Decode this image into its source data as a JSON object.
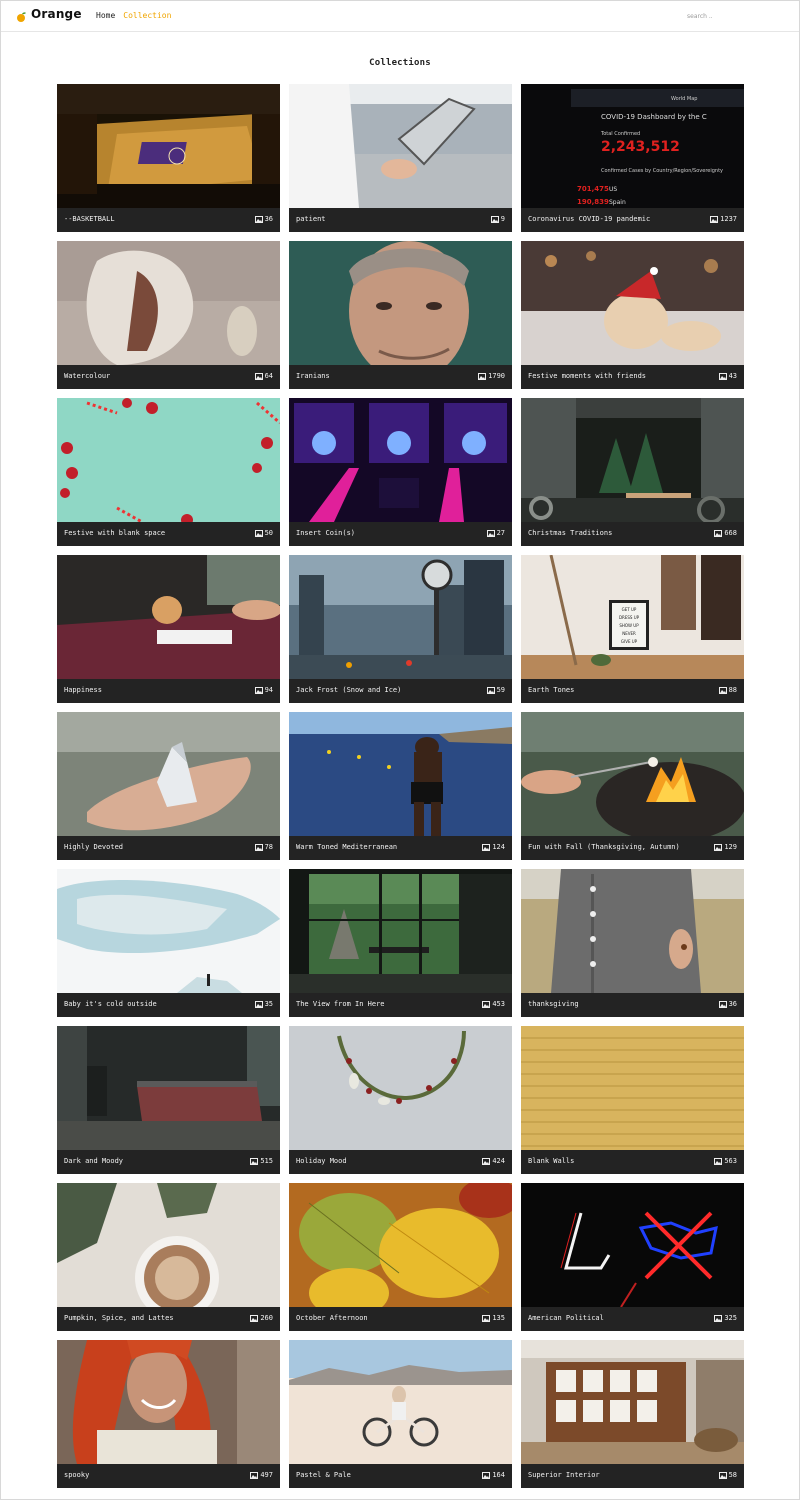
{
  "brand": {
    "name": "Orange",
    "logo_icon": "orange-fruit-icon",
    "accent": "#f0a500"
  },
  "nav": [
    {
      "label": "Home",
      "active": false
    },
    {
      "label": "Collection",
      "active": true
    }
  ],
  "search": {
    "placeholder": "search .."
  },
  "page_title": "Collections",
  "count_icon": "image-icon",
  "collections": [
    {
      "title": "--BASKETBALL",
      "count": "36"
    },
    {
      "title": "patient",
      "count": "9"
    },
    {
      "title": "Coronavirus COVID-19 pandemic",
      "count": "1237",
      "image_text": {
        "title": "COVID-19 Dashboard by the C",
        "label": "Total Confirmed",
        "total": "2,243,512",
        "sub": "Confirmed Cases by Country/Region/Sovereignty",
        "row1_num": "701,475",
        "row1_label": "US",
        "row2_num": "190,839",
        "row2_label": "Spain",
        "map_label": "World Map"
      }
    },
    {
      "title": "Watercolour",
      "count": "64"
    },
    {
      "title": "Iranians",
      "count": "1790"
    },
    {
      "title": "Festive moments with friends",
      "count": "43"
    },
    {
      "title": "Festive with blank space",
      "count": "50"
    },
    {
      "title": "Insert Coin(s)",
      "count": "27"
    },
    {
      "title": "Christmas Traditions",
      "count": "668"
    },
    {
      "title": "Happiness",
      "count": "94"
    },
    {
      "title": "Jack Frost (Snow and Ice)",
      "count": "59"
    },
    {
      "title": "Earth Tones",
      "count": "88",
      "image_text": {
        "sign": [
          "GET UP",
          "DRESS UP",
          "SHOW UP",
          "NEVER",
          "GIVE UP"
        ]
      }
    },
    {
      "title": "Highly Devoted",
      "count": "78"
    },
    {
      "title": "Warm Toned Mediterranean",
      "count": "124"
    },
    {
      "title": "Fun with Fall (Thanksgiving, Autumn)",
      "count": "129"
    },
    {
      "title": "Baby it's cold outside",
      "count": "35"
    },
    {
      "title": "The View from In Here",
      "count": "453"
    },
    {
      "title": "thanksgiving",
      "count": "36"
    },
    {
      "title": "Dark and Moody",
      "count": "515"
    },
    {
      "title": "Holiday Mood",
      "count": "424"
    },
    {
      "title": "Blank Walls",
      "count": "563"
    },
    {
      "title": "Pumpkin, Spice, and Lattes",
      "count": "260"
    },
    {
      "title": "October Afternoon",
      "count": "135"
    },
    {
      "title": "American Political",
      "count": "325"
    },
    {
      "title": "spooky",
      "count": "497"
    },
    {
      "title": "Pastel & Pale",
      "count": "164"
    },
    {
      "title": "Superior Interior",
      "count": "58"
    }
  ]
}
